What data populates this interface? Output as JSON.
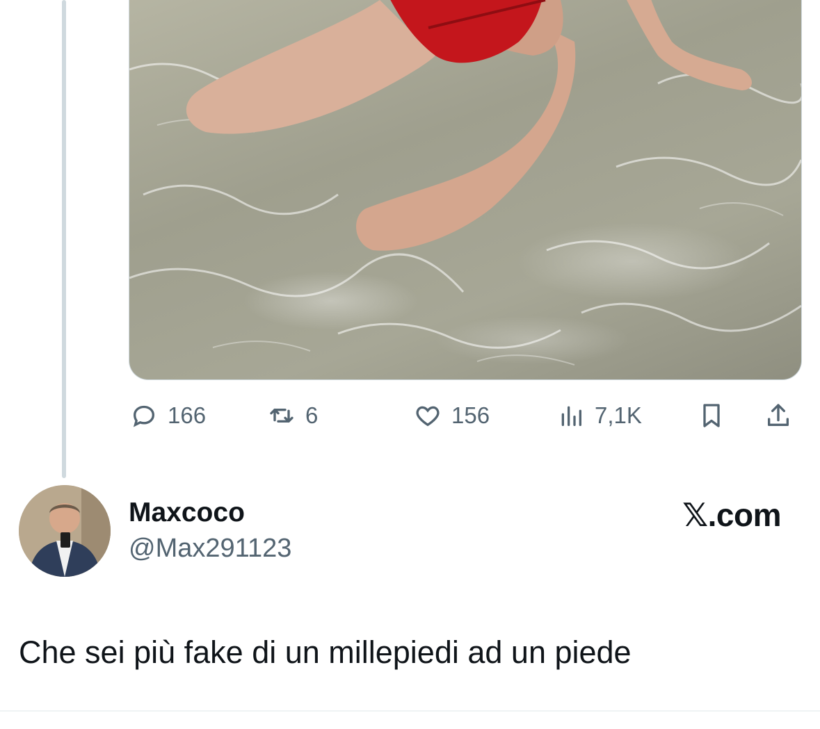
{
  "post": {
    "actions": {
      "reply_count": "166",
      "repost_count": "6",
      "like_count": "156",
      "view_count": "7,1K",
      "icons": [
        "reply-icon",
        "repost-icon",
        "like-icon",
        "views-icon",
        "bookmark-icon",
        "share-icon"
      ]
    }
  },
  "reply": {
    "display_name": "Maxcoco",
    "handle": "@Max291123",
    "text": "Che sei più fake di un millepiedi ad un piede"
  },
  "watermark": "𝕏.com",
  "colors": {
    "text_primary": "#0f1419",
    "text_secondary": "#536471",
    "thread_line": "#cfd9de",
    "bikini": "#c4161c"
  }
}
